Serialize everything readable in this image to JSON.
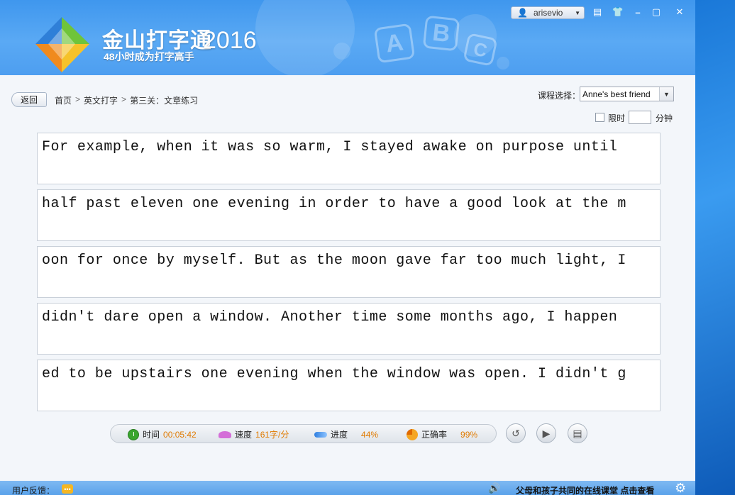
{
  "header": {
    "brand_title": "金山打字通",
    "brand_year": "2016",
    "slogan": "48小时成为打字高手",
    "abc_letters": [
      "A",
      "B",
      "C"
    ],
    "username": "arisevio",
    "window_icons": [
      "skin-icon",
      "shirt-icon",
      "minimize-icon",
      "maximize-icon",
      "close-icon"
    ],
    "colors": {
      "header": "#4d9ef0",
      "accent_orange": "#e07a00"
    }
  },
  "nav": {
    "back_label": "返回",
    "breadcrumb": [
      "首页",
      "英文打字",
      "第三关：文章练习"
    ],
    "course_label": "课程选择：",
    "course_value": "Anne's best friend",
    "limit_label": "限时",
    "limit_value": "",
    "limit_unit": "分钟"
  },
  "lines": [
    "For example, when it was so warm, I stayed awake on purpose until",
    "half past eleven one evening in order to have a good look at the m",
    "oon for once by myself. But as the moon gave far too much light, I",
    "didn't dare open a window. Another time some months ago, I happen",
    "ed to be upstairs one evening when the window was open. I didn't g"
  ],
  "stats": {
    "time_label": "时间",
    "time_value": "00:05:42",
    "speed_label": "速度",
    "speed_value": "161字/分",
    "progress_label": "进度",
    "progress_value": "44%",
    "accuracy_label": "正确率",
    "accuracy_value": "99%"
  },
  "footer": {
    "feedback_label": "用户反馈：",
    "promo_text": "父母和孩子共同的在线课堂 点击查看"
  }
}
